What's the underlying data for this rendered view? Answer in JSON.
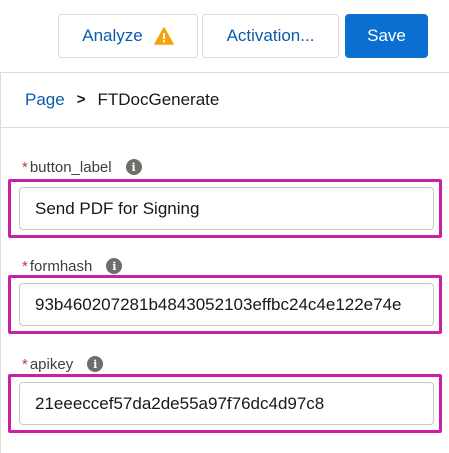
{
  "toolbar": {
    "analyze_label": "Analyze",
    "activation_label": "Activation...",
    "save_label": "Save",
    "warning_color": "#f4a40c"
  },
  "breadcrumb": {
    "parent": "Page",
    "separator": ">",
    "current": "FTDocGenerate"
  },
  "fields": [
    {
      "label": "button_label",
      "required": "*",
      "value": "Send PDF for Signing"
    },
    {
      "label": "formhash",
      "required": "*",
      "value": "93b460207281b4843052103effbc24c4e122e74e"
    },
    {
      "label": "apikey",
      "required": "*",
      "value": "21eeeccef57da2de55a97f76dc4d97c8"
    }
  ],
  "colors": {
    "brand": "#0b6fd1",
    "link": "#0b5cab",
    "highlight": "#cc1fa8",
    "required": "#c23934"
  }
}
